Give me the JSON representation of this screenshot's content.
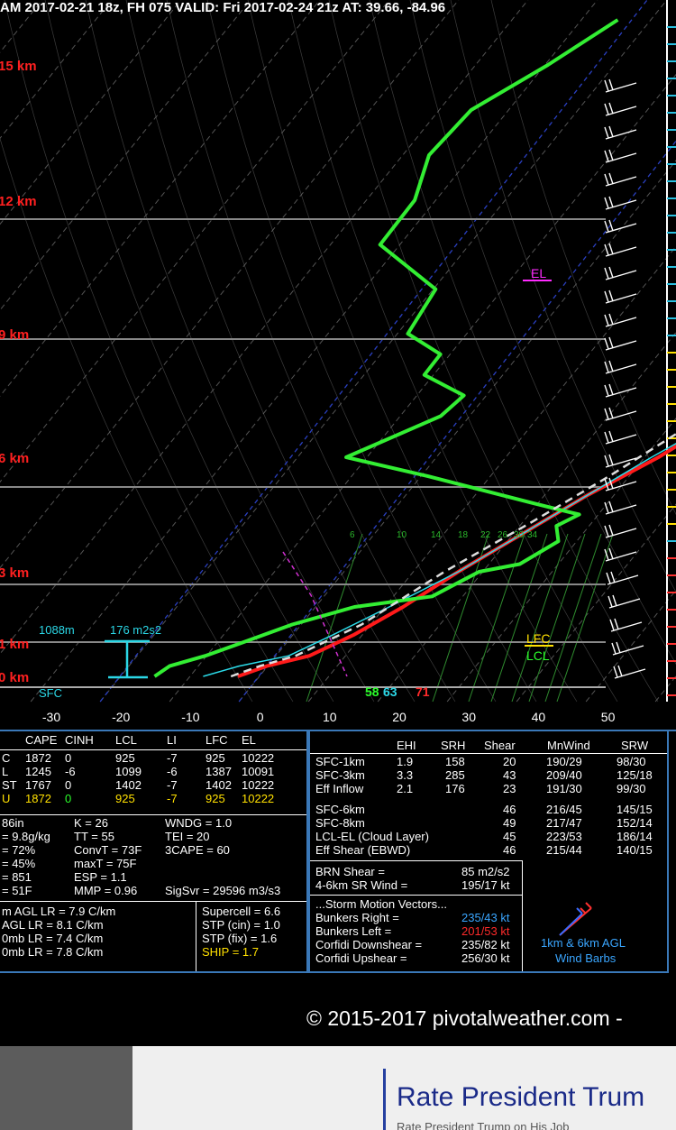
{
  "header": {
    "text": "AM 2017-02-21 18z, FH 075   VALID: Fri 2017-02-24 21z   AT: 39.66, -84.96"
  },
  "chart_data": {
    "type": "line",
    "title": "",
    "xlabel": "",
    "ylabel": "",
    "x_ticks": [
      "-30",
      "-20",
      "-10",
      "0",
      "10",
      "20",
      "30",
      "40",
      "50"
    ],
    "xlim": [
      -38,
      60
    ],
    "height_labels": [
      "15 km",
      "12 km",
      "9 km",
      "6 km",
      "3 km",
      "1 km",
      "0 km"
    ],
    "sfc_label": "SFC",
    "mixing_ratio_labels": [
      "6",
      "10",
      "14",
      "18",
      "22",
      "26",
      "30",
      "34"
    ],
    "parcel_labels": {
      "el": "EL",
      "lfc": "LFC",
      "lcl": "LCL"
    },
    "helicity": {
      "depth": "1088m",
      "value": "176 m2s2"
    },
    "surface_readout": {
      "dewpoint": "58",
      "virtual": "63",
      "temp": "71"
    },
    "series": [
      {
        "color": "#ff1a1a",
        "points": [
          [
            -3,
            0
          ],
          [
            0,
            0.3
          ],
          [
            5,
            0.6
          ],
          [
            9,
            1.2
          ],
          [
            13,
            2
          ],
          [
            17,
            3
          ],
          [
            22,
            4
          ],
          [
            27,
            5
          ],
          [
            33,
            6
          ],
          [
            38,
            7
          ],
          [
            42,
            8
          ],
          [
            45,
            9
          ],
          [
            50,
            10
          ],
          [
            55,
            11
          ],
          [
            60,
            12
          ],
          [
            63,
            13
          ],
          [
            66,
            14
          ],
          [
            69,
            15
          ],
          [
            72,
            16
          ]
        ]
      },
      {
        "color": "#2bdcea",
        "points": [
          [
            -8,
            0
          ],
          [
            -4,
            0.3
          ],
          [
            2,
            0.6
          ],
          [
            6,
            1.2
          ],
          [
            11,
            2
          ],
          [
            17,
            3
          ],
          [
            22,
            4
          ],
          [
            27,
            5
          ],
          [
            32,
            6
          ],
          [
            38,
            7
          ],
          [
            43,
            8
          ],
          [
            46,
            9
          ],
          [
            51,
            10
          ],
          [
            56,
            11
          ],
          [
            62,
            12
          ],
          [
            64,
            13
          ],
          [
            67,
            14
          ],
          [
            70,
            15
          ],
          [
            73,
            16
          ]
        ]
      },
      {
        "color": "#33ee33",
        "points": [
          [
            -15,
            0
          ],
          [
            -14,
            0.3
          ],
          [
            -10,
            0.6
          ],
          [
            -6,
            1.0
          ],
          [
            -1,
            1.5
          ],
          [
            6,
            2
          ],
          [
            16,
            2.3
          ],
          [
            20,
            3
          ],
          [
            25,
            3.2
          ],
          [
            28,
            3.8
          ],
          [
            26,
            4.2
          ],
          [
            28,
            4.5
          ],
          [
            20,
            4.8
          ],
          [
            2,
            5.5
          ],
          [
            -12,
            6
          ],
          [
            -3,
            7
          ],
          [
            -2,
            7.5
          ],
          [
            -10,
            8
          ],
          [
            -10,
            8.5
          ],
          [
            -17,
            9
          ],
          [
            -18,
            10
          ],
          [
            -31,
            11
          ],
          [
            -31,
            12
          ],
          [
            -34,
            13
          ],
          [
            -33,
            14
          ],
          [
            -27,
            15
          ],
          [
            -22,
            16
          ]
        ]
      },
      {
        "color": "#dddddd",
        "points": [
          [
            -4,
            0
          ],
          [
            -1,
            0.3
          ],
          [
            3,
            0.6
          ],
          [
            9,
            1.5
          ],
          [
            15,
            3
          ],
          [
            22,
            4.3
          ],
          [
            28,
            5.5
          ],
          [
            35,
            7
          ],
          [
            42,
            8.5
          ],
          [
            51,
            10
          ],
          [
            61,
            12
          ],
          [
            70,
            14
          ],
          [
            80,
            16
          ]
        ]
      }
    ],
    "parameters_left": {
      "headers": [
        "",
        "CAPE",
        "CINH",
        "LCL",
        "LI",
        "LFC",
        "EL"
      ],
      "rows": [
        [
          "C",
          "1872",
          "0",
          "925",
          "-7",
          "925",
          "10222"
        ],
        [
          "L",
          "1245",
          "-6",
          "1099",
          "-6",
          "1387",
          "10091"
        ],
        [
          "ST",
          "1767",
          "0",
          "1402",
          "-7",
          "1402",
          "10222"
        ],
        [
          "U",
          "1872",
          "0",
          "925",
          "-7",
          "925",
          "10222"
        ]
      ],
      "indices": [
        [
          "86in",
          "K = 26",
          "WNDG = 1.0"
        ],
        [
          "= 9.8g/kg",
          "TT = 55",
          "TEI = 20"
        ],
        [
          "= 72%",
          "ConvT = 73F",
          "3CAPE = 60"
        ],
        [
          "= 45%",
          "maxT = 75F",
          ""
        ],
        [
          "= 851",
          "ESP = 1.1",
          ""
        ],
        [
          "= 51F",
          "MMP = 0.96",
          "SigSvr = 29596 m3/s3"
        ]
      ],
      "lapse_rates": [
        "m AGL LR = 7.9 C/km",
        "AGL LR = 8.1 C/km",
        "0mb LR = 7.4 C/km",
        "0mb LR = 7.8 C/km"
      ],
      "composite": [
        "Supercell = 6.6",
        "STP (cin) = 1.0",
        "STP (fix) = 1.6",
        "SHIP = 1.7"
      ]
    },
    "parameters_right": {
      "headers": [
        "EHI",
        "SRH",
        "Shear",
        "MnWind",
        "SRW"
      ],
      "rows": [
        [
          "SFC-1km",
          "1.9",
          "158",
          "20",
          "190/29",
          "98/30"
        ],
        [
          "SFC-3km",
          "3.3",
          "285",
          "43",
          "209/40",
          "125/18"
        ],
        [
          "Eff Inflow",
          "2.1",
          "176",
          "23",
          "191/30",
          "99/30"
        ],
        [
          "SFC-6km",
          "",
          "",
          "46",
          "216/45",
          "145/15"
        ],
        [
          "SFC-8km",
          "",
          "",
          "49",
          "217/47",
          "152/14"
        ],
        [
          "LCL-EL (Cloud Layer)",
          "",
          "",
          "45",
          "223/53",
          "186/14"
        ],
        [
          "Eff Shear (EBWD)",
          "",
          "",
          "46",
          "215/44",
          "140/15"
        ]
      ],
      "brn_shear": {
        "label": "BRN Shear =",
        "value": "85 m2/s2"
      },
      "sr_wind": {
        "label": "4-6km SR Wind =",
        "value": "195/17 kt"
      },
      "storm_motion_title": "...Storm Motion Vectors...",
      "storm_motion": [
        {
          "label": "Bunkers Right =",
          "value": "235/43 kt",
          "color": "#3aa6ff"
        },
        {
          "label": "Bunkers Left =",
          "value": "201/53 kt",
          "color": "#ff2a2a"
        },
        {
          "label": "Corfidi Downshear =",
          "value": "235/82 kt",
          "color": "#ffffff"
        },
        {
          "label": "Corfidi Upshear =",
          "value": "256/30 kt",
          "color": "#ffffff"
        }
      ],
      "wind_barb_legend": [
        "1km & 6km AGL",
        "Wind Barbs"
      ]
    }
  },
  "footer": {
    "copyright": "© 2015-2017 pivotalweather.com -"
  },
  "ad": {
    "title": "Rate President Trum",
    "subtitle": "Rate President Trump on His Job"
  }
}
